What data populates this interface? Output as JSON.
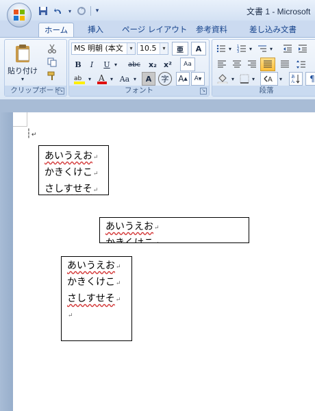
{
  "window": {
    "title": "文書 1 - Microsoft"
  },
  "qat": {
    "save": "save-icon",
    "undo": "undo-icon",
    "redo": "redo-icon",
    "customize": "▾"
  },
  "tabs": [
    {
      "label": "ホーム",
      "active": true
    },
    {
      "label": "挿入"
    },
    {
      "label": "ページ レイアウト"
    },
    {
      "label": "参考資料"
    },
    {
      "label": "差し込み文書"
    }
  ],
  "clipboard": {
    "paste_label": "貼り付け",
    "group_label": "クリップボード"
  },
  "font": {
    "name": "MS 明朝 (本文",
    "size": "10.5",
    "group_label": "フォント",
    "bold": "B",
    "italic": "I",
    "underline": "U",
    "strike": "abc",
    "sub": "x₂",
    "sup": "x²",
    "clear": "Aa",
    "grow": "A",
    "shrink": "A",
    "change_case": "Aa",
    "char_border": "A",
    "enclose": "字"
  },
  "paragraph": {
    "group_label": "段落"
  },
  "textboxes": [
    {
      "lines": [
        "あいうえお",
        "かきくけこ",
        "さしすせそ"
      ]
    },
    {
      "lines": [
        "あいうえお",
        "かきくけこ"
      ]
    },
    {
      "lines": [
        "あいうえお",
        "かきくけこ",
        "さしすせそ"
      ]
    }
  ],
  "colors": {
    "accent": "#15428b",
    "ribbon_bg": "#dce8f6",
    "doc_bg": "#a8bcd6"
  }
}
